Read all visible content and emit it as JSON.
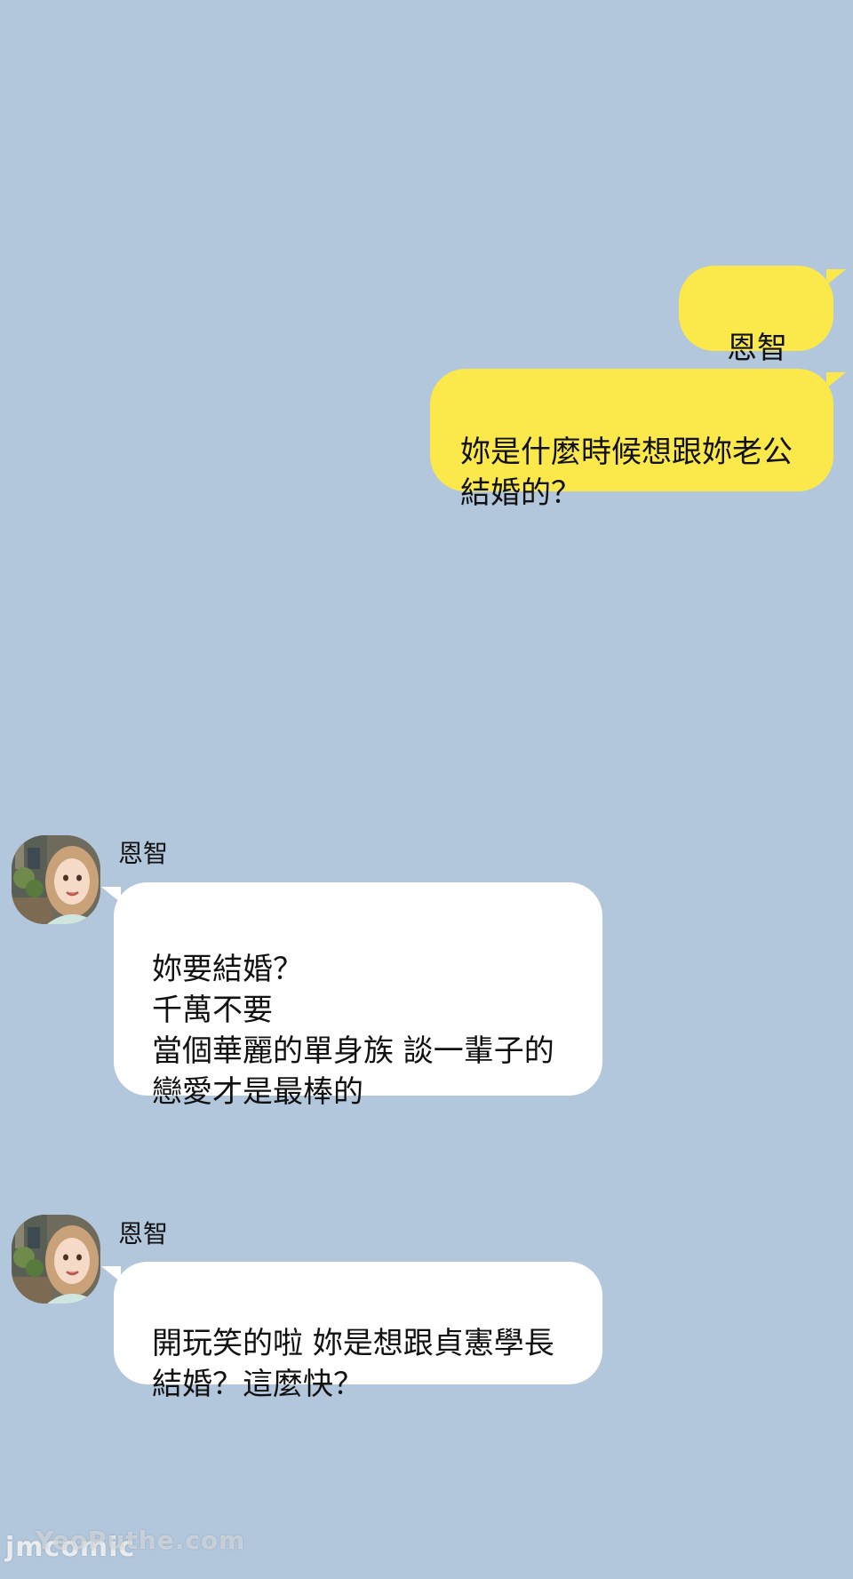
{
  "chat": {
    "outgoing": [
      {
        "text": "恩智"
      },
      {
        "text": "妳是什麼時候想跟妳老公\n結婚的？"
      }
    ],
    "incoming": [
      {
        "sender": "恩智",
        "text": "妳要結婚？\n千萬不要\n當個華麗的單身族 談一輩子的\n戀愛才是最棒的"
      },
      {
        "sender": "恩智",
        "text": "開玩笑的啦 妳是想跟貞憲學長\n結婚？這麼快？"
      }
    ]
  },
  "colors": {
    "background": "#b3c7dc",
    "outgoing_bubble": "#fbe94b",
    "incoming_bubble": "#ffffff"
  },
  "watermark": {
    "main": "jmcomic",
    "sub": "YeoPuthe.com"
  }
}
